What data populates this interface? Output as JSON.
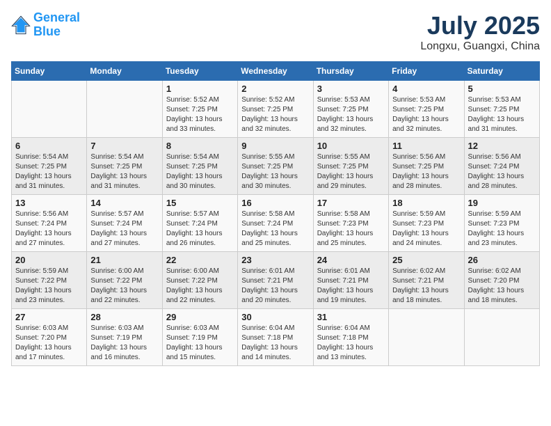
{
  "header": {
    "logo_line1": "General",
    "logo_line2": "Blue",
    "month": "July 2025",
    "location": "Longxu, Guangxi, China"
  },
  "weekdays": [
    "Sunday",
    "Monday",
    "Tuesday",
    "Wednesday",
    "Thursday",
    "Friday",
    "Saturday"
  ],
  "weeks": [
    [
      {
        "day": "",
        "info": ""
      },
      {
        "day": "",
        "info": ""
      },
      {
        "day": "1",
        "info": "Sunrise: 5:52 AM\nSunset: 7:25 PM\nDaylight: 13 hours and 33 minutes."
      },
      {
        "day": "2",
        "info": "Sunrise: 5:52 AM\nSunset: 7:25 PM\nDaylight: 13 hours and 32 minutes."
      },
      {
        "day": "3",
        "info": "Sunrise: 5:53 AM\nSunset: 7:25 PM\nDaylight: 13 hours and 32 minutes."
      },
      {
        "day": "4",
        "info": "Sunrise: 5:53 AM\nSunset: 7:25 PM\nDaylight: 13 hours and 32 minutes."
      },
      {
        "day": "5",
        "info": "Sunrise: 5:53 AM\nSunset: 7:25 PM\nDaylight: 13 hours and 31 minutes."
      }
    ],
    [
      {
        "day": "6",
        "info": "Sunrise: 5:54 AM\nSunset: 7:25 PM\nDaylight: 13 hours and 31 minutes."
      },
      {
        "day": "7",
        "info": "Sunrise: 5:54 AM\nSunset: 7:25 PM\nDaylight: 13 hours and 31 minutes."
      },
      {
        "day": "8",
        "info": "Sunrise: 5:54 AM\nSunset: 7:25 PM\nDaylight: 13 hours and 30 minutes."
      },
      {
        "day": "9",
        "info": "Sunrise: 5:55 AM\nSunset: 7:25 PM\nDaylight: 13 hours and 30 minutes."
      },
      {
        "day": "10",
        "info": "Sunrise: 5:55 AM\nSunset: 7:25 PM\nDaylight: 13 hours and 29 minutes."
      },
      {
        "day": "11",
        "info": "Sunrise: 5:56 AM\nSunset: 7:25 PM\nDaylight: 13 hours and 28 minutes."
      },
      {
        "day": "12",
        "info": "Sunrise: 5:56 AM\nSunset: 7:24 PM\nDaylight: 13 hours and 28 minutes."
      }
    ],
    [
      {
        "day": "13",
        "info": "Sunrise: 5:56 AM\nSunset: 7:24 PM\nDaylight: 13 hours and 27 minutes."
      },
      {
        "day": "14",
        "info": "Sunrise: 5:57 AM\nSunset: 7:24 PM\nDaylight: 13 hours and 27 minutes."
      },
      {
        "day": "15",
        "info": "Sunrise: 5:57 AM\nSunset: 7:24 PM\nDaylight: 13 hours and 26 minutes."
      },
      {
        "day": "16",
        "info": "Sunrise: 5:58 AM\nSunset: 7:24 PM\nDaylight: 13 hours and 25 minutes."
      },
      {
        "day": "17",
        "info": "Sunrise: 5:58 AM\nSunset: 7:23 PM\nDaylight: 13 hours and 25 minutes."
      },
      {
        "day": "18",
        "info": "Sunrise: 5:59 AM\nSunset: 7:23 PM\nDaylight: 13 hours and 24 minutes."
      },
      {
        "day": "19",
        "info": "Sunrise: 5:59 AM\nSunset: 7:23 PM\nDaylight: 13 hours and 23 minutes."
      }
    ],
    [
      {
        "day": "20",
        "info": "Sunrise: 5:59 AM\nSunset: 7:22 PM\nDaylight: 13 hours and 23 minutes."
      },
      {
        "day": "21",
        "info": "Sunrise: 6:00 AM\nSunset: 7:22 PM\nDaylight: 13 hours and 22 minutes."
      },
      {
        "day": "22",
        "info": "Sunrise: 6:00 AM\nSunset: 7:22 PM\nDaylight: 13 hours and 22 minutes."
      },
      {
        "day": "23",
        "info": "Sunrise: 6:01 AM\nSunset: 7:21 PM\nDaylight: 13 hours and 20 minutes."
      },
      {
        "day": "24",
        "info": "Sunrise: 6:01 AM\nSunset: 7:21 PM\nDaylight: 13 hours and 19 minutes."
      },
      {
        "day": "25",
        "info": "Sunrise: 6:02 AM\nSunset: 7:21 PM\nDaylight: 13 hours and 18 minutes."
      },
      {
        "day": "26",
        "info": "Sunrise: 6:02 AM\nSunset: 7:20 PM\nDaylight: 13 hours and 18 minutes."
      }
    ],
    [
      {
        "day": "27",
        "info": "Sunrise: 6:03 AM\nSunset: 7:20 PM\nDaylight: 13 hours and 17 minutes."
      },
      {
        "day": "28",
        "info": "Sunrise: 6:03 AM\nSunset: 7:19 PM\nDaylight: 13 hours and 16 minutes."
      },
      {
        "day": "29",
        "info": "Sunrise: 6:03 AM\nSunset: 7:19 PM\nDaylight: 13 hours and 15 minutes."
      },
      {
        "day": "30",
        "info": "Sunrise: 6:04 AM\nSunset: 7:18 PM\nDaylight: 13 hours and 14 minutes."
      },
      {
        "day": "31",
        "info": "Sunrise: 6:04 AM\nSunset: 7:18 PM\nDaylight: 13 hours and 13 minutes."
      },
      {
        "day": "",
        "info": ""
      },
      {
        "day": "",
        "info": ""
      }
    ]
  ]
}
